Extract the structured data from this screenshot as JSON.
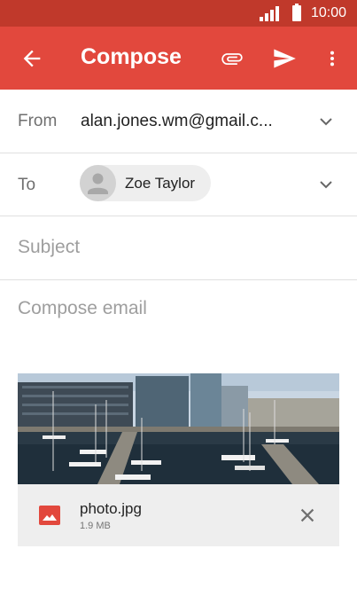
{
  "status_bar": {
    "time": "10:00"
  },
  "app_bar": {
    "title": "Compose",
    "color": "#e2483d"
  },
  "from": {
    "label": "From",
    "value": "alan.jones.wm@gmail.c..."
  },
  "to": {
    "label": "To",
    "recipient_name": "Zoe Taylor"
  },
  "subject": {
    "placeholder": "Subject"
  },
  "body": {
    "placeholder": "Compose email"
  },
  "attachment": {
    "filename": "photo.jpg",
    "size": "1.9 MB"
  },
  "icons": [
    "back-arrow-icon",
    "paperclip-icon",
    "send-icon",
    "more-vert-icon",
    "chevron-down-icon",
    "avatar-icon",
    "image-icon",
    "close-icon"
  ]
}
